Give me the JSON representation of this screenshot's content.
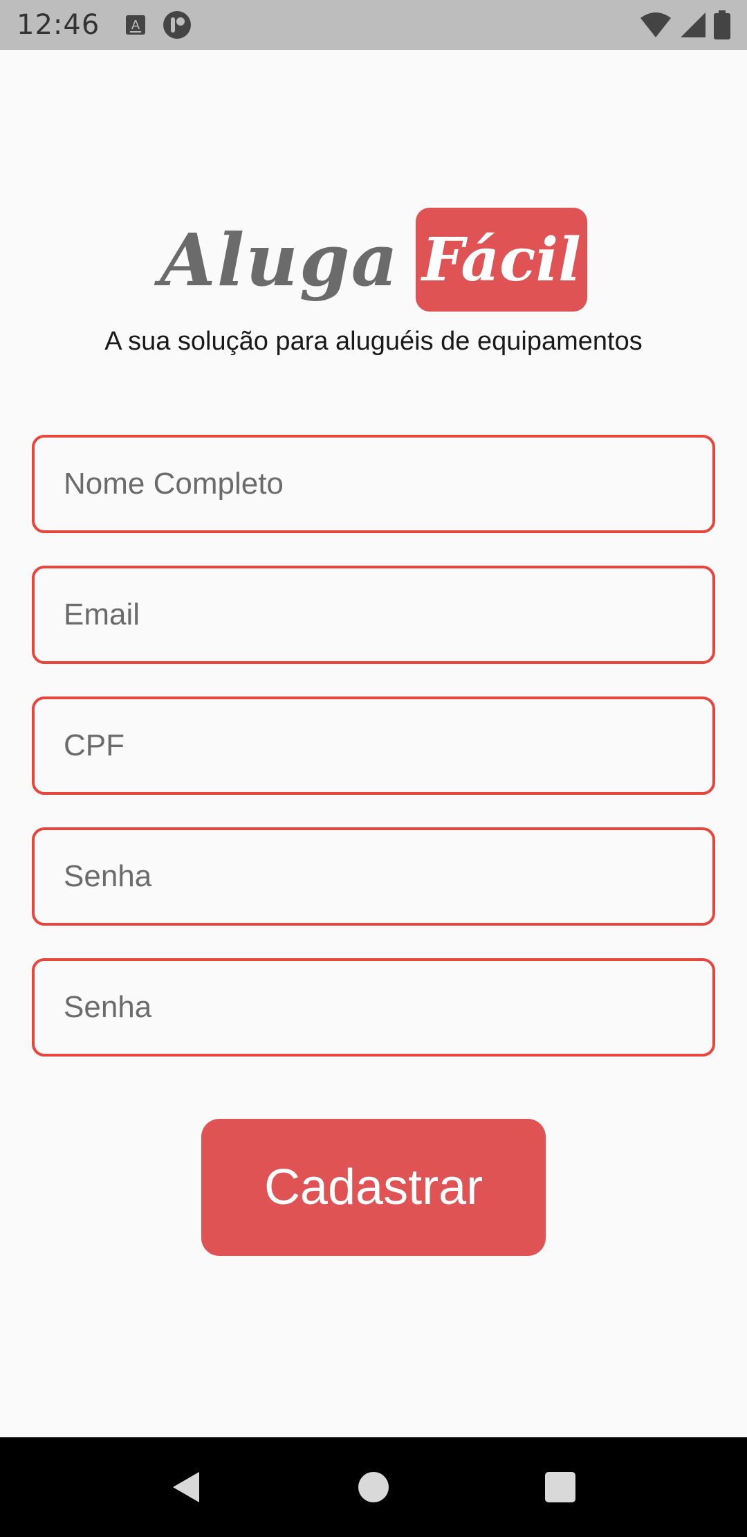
{
  "status_bar": {
    "time": "12:46",
    "icons_left": [
      "keyboard-a-icon",
      "app-notification-icon"
    ],
    "icons_right": [
      "wifi-icon",
      "cell-signal-icon",
      "battery-icon"
    ]
  },
  "logo": {
    "word_1": "Aluga",
    "word_2": "Fácil"
  },
  "subtitle": "A sua solução para aluguéis de equipamentos",
  "form": {
    "fields": [
      {
        "placeholder": "Nome Completo",
        "value": ""
      },
      {
        "placeholder": "Email",
        "value": ""
      },
      {
        "placeholder": "CPF",
        "value": ""
      },
      {
        "placeholder": "Senha",
        "value": ""
      },
      {
        "placeholder": "Senha",
        "value": ""
      }
    ],
    "submit_label": "Cadastrar"
  },
  "colors": {
    "accent": "#df5355",
    "field_border": "#e8453c",
    "logo_gray": "#6b6b6b",
    "background": "#fafafa"
  },
  "nav_bar": {
    "icons": [
      "back-icon",
      "home-icon",
      "recent-apps-icon"
    ]
  }
}
